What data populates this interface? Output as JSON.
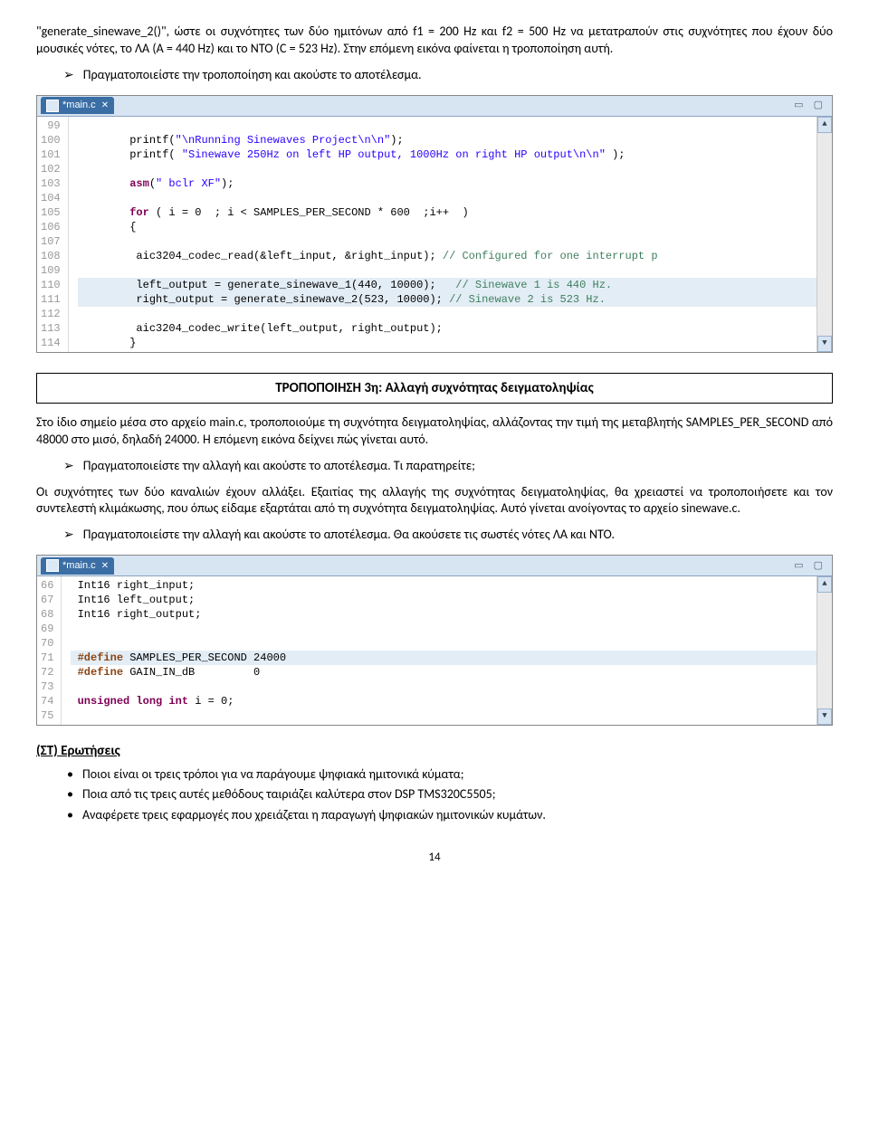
{
  "intro": {
    "p1": "\"generate_sinewave_2()\", ώστε οι συχνότητες των δύο ημιτόνων από f1 = 200 Hz και f2 = 500 Hz να μετατραπούν στις συχνότητες που έχουν δύο μουσικές νότες, το ΛΑ (A = 440 Hz) και το ΝΤΟ (C = 523 Hz). Στην επόμενη εικόνα φαίνεται η τροποποίηση αυτή.",
    "task1": "Πραγματοποιείστε την τροποποίηση και ακούστε το αποτέλεσμα."
  },
  "editor1": {
    "tab": "*main.c",
    "minmax": "▭ ▢",
    "gutter": [
      "99",
      "100",
      "101",
      "102",
      "103",
      "104",
      "105",
      "106",
      "107",
      "108",
      "109",
      "110",
      "111",
      "112",
      "113",
      "114"
    ],
    "lines": {
      "l99": "",
      "l100a": "        printf(",
      "l100b": "\"\\nRunning Sinewaves Project\\n\\n\"",
      "l100c": ");",
      "l101a": "        printf( ",
      "l101b": "\"Sinewave 250Hz on left HP output, 1000Hz on right HP output\\n\\n\"",
      "l101c": " );",
      "l102": "",
      "l103a": "        ",
      "l103kw": "asm",
      "l103b": "(",
      "l103s": "\" bclr XF\"",
      "l103c": ");",
      "l104": "",
      "l105a": "        ",
      "l105kw": "for",
      "l105b": " ( i = 0  ; i < SAMPLES_PER_SECOND * 600  ;i++  )",
      "l106": "        {",
      "l107": "",
      "l108a": "         aic3204_codec_read(&left_input, &right_input); ",
      "l108c": "// Configured for one interrupt p",
      "l109": "",
      "l110a": "         left_output = generate_sinewave_1(440, 10000);   ",
      "l110c": "// Sinewave 1 is 440 Hz.",
      "l111a": "         right_output = generate_sinewave_2(523, 10000); ",
      "l111c": "// Sinewave 2 is 523 Hz.",
      "l112": "",
      "l113": "         aic3204_codec_write(left_output, right_output);",
      "l114": "        }"
    }
  },
  "section3": {
    "title": "ΤΡΟΠΟΠΟΙΗΣΗ 3η: Αλλαγή συχνότητας δειγματοληψίας",
    "p1": "Στο ίδιο σημείο μέσα στο αρχείο main.c, τροποποιούμε τη συχνότητα δειγματοληψίας, αλλάζοντας την τιμή της μεταβλητής SAMPLES_PER_SECOND από 48000 στο μισό, δηλαδή 24000. Η επόμενη εικόνα δείχνει πώς γίνεται αυτό.",
    "task1": "Πραγματοποιείστε την αλλαγή και ακούστε το αποτέλεσμα. Τι παρατηρείτε;",
    "p2": "Οι συχνότητες των δύο καναλιών έχουν αλλάξει. Εξαιτίας της αλλαγής της συχνότητας δειγματοληψίας, θα χρειαστεί να τροποποιήσετε και τον συντελεστή κλιμάκωσης, που όπως είδαμε εξαρτάται από τη συχνότητα δειγματοληψίας. Αυτό γίνεται ανοίγοντας το αρχείο sinewave.c.",
    "task2": "Πραγματοποιείστε την αλλαγή και ακούστε το αποτέλεσμα. Θα ακούσετε τις σωστές νότες ΛΑ και ΝΤΟ."
  },
  "editor2": {
    "tab": "*main.c",
    "minmax": "▭ ▢",
    "gutter": [
      "66",
      "67",
      "68",
      "69",
      "70",
      "71",
      "72",
      "73",
      "74",
      "75"
    ],
    "lines": {
      "l66": " Int16 right_input;",
      "l67": " Int16 left_output;",
      "l68": " Int16 right_output;",
      "l69": "",
      "l70": "",
      "l71a": " ",
      "l71p": "#define",
      "l71b": " SAMPLES_PER_SECOND 24000",
      "l72a": " ",
      "l72p": "#define",
      "l72b": " GAIN_IN_dB         0",
      "l73": "",
      "l74a": " ",
      "l74k": "unsigned long int",
      "l74b": " i = 0;",
      "l75": ""
    }
  },
  "questions": {
    "heading": "(ΣΤ) Ερωτήσεις",
    "q1": "Ποιοι είναι οι τρεις τρόποι για να παράγουμε ψηφιακά ημιτονικά κύματα;",
    "q2": "Ποια από τις τρεις αυτές μεθόδους ταιριάζει καλύτερα στον DSP TMS320C5505;",
    "q3": "Αναφέρετε τρεις εφαρμογές που χρειάζεται η παραγωγή ψηφιακών ημιτονικών κυμάτων."
  },
  "pagenum": "14"
}
